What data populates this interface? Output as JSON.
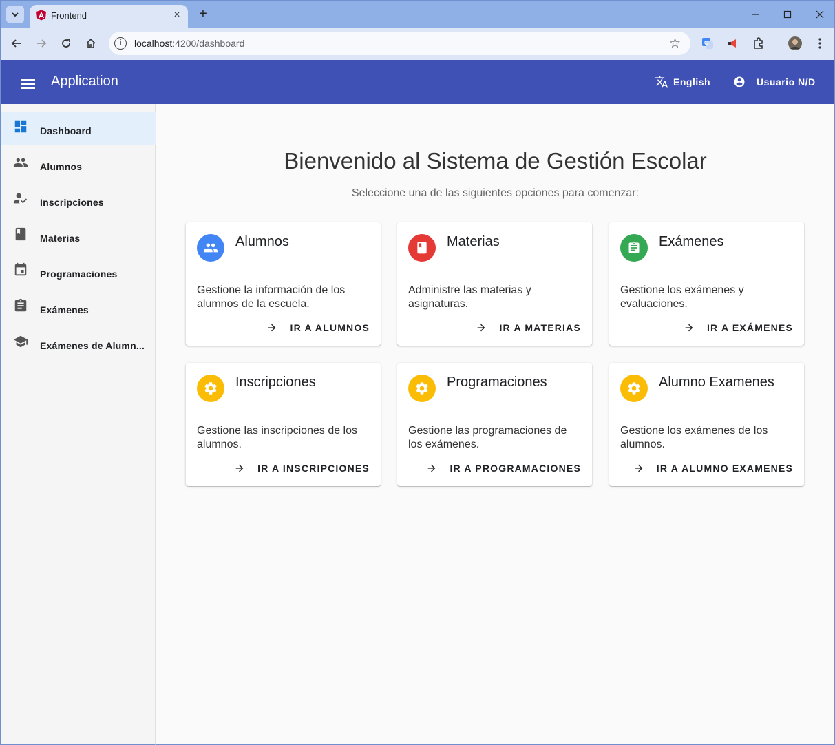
{
  "browser": {
    "tab_title": "Frontend",
    "url_host": "localhost",
    "url_rest": ":4200/dashboard"
  },
  "header": {
    "title": "Application",
    "language": "English",
    "user": "Usuario N/D"
  },
  "sidebar": {
    "items": [
      {
        "label": "Dashboard",
        "icon": "dashboard-icon",
        "active": true
      },
      {
        "label": "Alumnos",
        "icon": "people-icon"
      },
      {
        "label": "Inscripciones",
        "icon": "how-to-reg-icon"
      },
      {
        "label": "Materias",
        "icon": "book-icon"
      },
      {
        "label": "Programaciones",
        "icon": "event-icon"
      },
      {
        "label": "Exámenes",
        "icon": "assignment-icon"
      },
      {
        "label": "Exámenes de Alumn...",
        "icon": "school-icon"
      }
    ]
  },
  "main": {
    "title": "Bienvenido al Sistema de Gestión Escolar",
    "subtitle": "Seleccione una de las siguientes opciones para comenzar:",
    "cards": [
      {
        "title": "Alumnos",
        "description": "Gestione la información de los alumnos de la escuela.",
        "action": "IR A ALUMNOS",
        "icon": "people-icon",
        "color": "#4285f4"
      },
      {
        "title": "Materias",
        "description": "Administre las materias y asignaturas.",
        "action": "IR A MATERIAS",
        "icon": "book-icon",
        "color": "#e53935"
      },
      {
        "title": "Exámenes",
        "description": "Gestione los exámenes y evaluaciones.",
        "action": "IR A EXÁMENES",
        "icon": "assignment-icon",
        "color": "#34a853"
      },
      {
        "title": "Inscripciones",
        "description": "Gestione las inscripciones de los alumnos.",
        "action": "IR A INSCRIPCIONES",
        "icon": "gear-icon",
        "color": "#fbbc05"
      },
      {
        "title": "Programaciones",
        "description": "Gestione las programaciones de los exámenes.",
        "action": "IR A PROGRAMACIONES",
        "icon": "gear-icon",
        "color": "#fbbc05"
      },
      {
        "title": "Alumno Examenes",
        "description": "Gestione los exámenes de los alumnos.",
        "action": "IR A ALUMNO EXAMENES",
        "icon": "gear-icon",
        "color": "#fbbc05"
      }
    ]
  },
  "colors": {
    "header": "#3f51b5",
    "sidebar_active": "#e3f0fc",
    "icon_blue": "#1976d2"
  }
}
